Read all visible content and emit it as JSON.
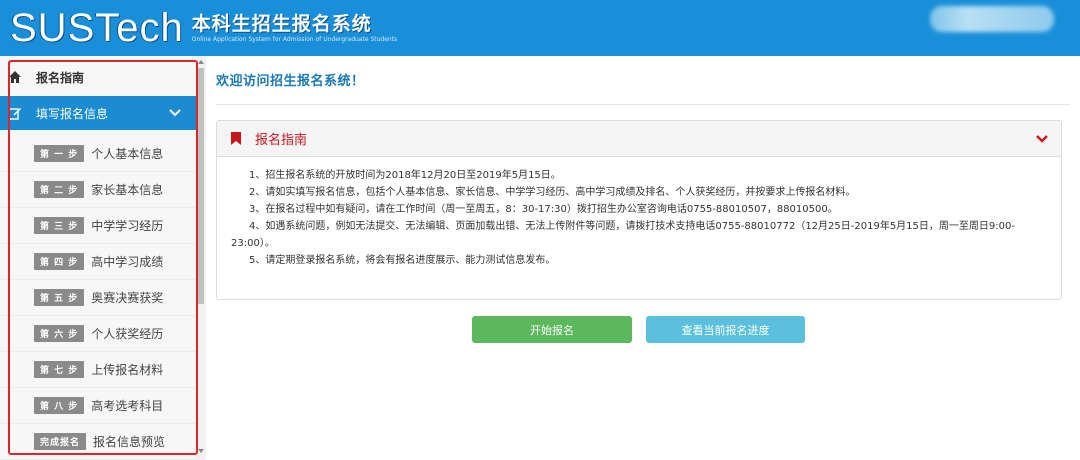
{
  "header": {
    "logo_text": "SUSTech",
    "logo_cn": "本科生招生报名系统",
    "logo_en": "Online Application System for Admission of Undergraduate Students"
  },
  "sidebar": {
    "guide_label": "报名指南",
    "fill_label": "填写报名信息",
    "steps": [
      {
        "badge": "第 一 步",
        "label": "个人基本信息"
      },
      {
        "badge": "第 二 步",
        "label": "家长基本信息"
      },
      {
        "badge": "第 三 步",
        "label": "中学学习经历"
      },
      {
        "badge": "第 四 步",
        "label": "高中学习成绩"
      },
      {
        "badge": "第 五 步",
        "label": "奥赛决赛获奖"
      },
      {
        "badge": "第 六 步",
        "label": "个人获奖经历"
      },
      {
        "badge": "第 七 步",
        "label": "上传报名材料"
      },
      {
        "badge": "第 八 步",
        "label": "高考选考科目"
      },
      {
        "badge": "完成报名",
        "label": "报名信息预览"
      }
    ]
  },
  "main": {
    "welcome": "欢迎访问招生报名系统！",
    "panel_title": "报名指南",
    "guide_lines": [
      "1、招生报名系统的开放时间为2018年12月20日至2019年5月15日。",
      "2、请如实填写报名信息，包括个人基本信息、家长信息、中学学习经历、高中学习成绩及排名、个人获奖经历，并按要求上传报名材料。",
      "3、在报名过程中如有疑问，请在工作时间（周一至周五，8：30-17:30）拨打招生办公室咨询电话0755-88010507，88010500。",
      "4、如遇系统问题，例如无法提交、无法编辑、页面加载出错、无法上传附件等问题，请拨打技术支持电话0755-88010772（12月25日-2019年5月15日，周一至周日9:00-23:00）。",
      "5、请定期登录报名系统，将会有报名进度展示、能力测试信息发布。"
    ],
    "btn_start": "开始报名",
    "btn_progress": "查看当前报名进度"
  },
  "colors": {
    "header_bg": "#1a8fd9",
    "active_nav": "#1b8bd2",
    "panel_title": "#c8161d",
    "btn_start": "#5cb85c",
    "btn_progress": "#5bc0de",
    "highlight_frame": "#d9282b"
  },
  "icons": {
    "guide": "home-icon",
    "fill": "edit-icon",
    "panel": "bookmark-icon",
    "expand": "chevron-down-icon"
  }
}
